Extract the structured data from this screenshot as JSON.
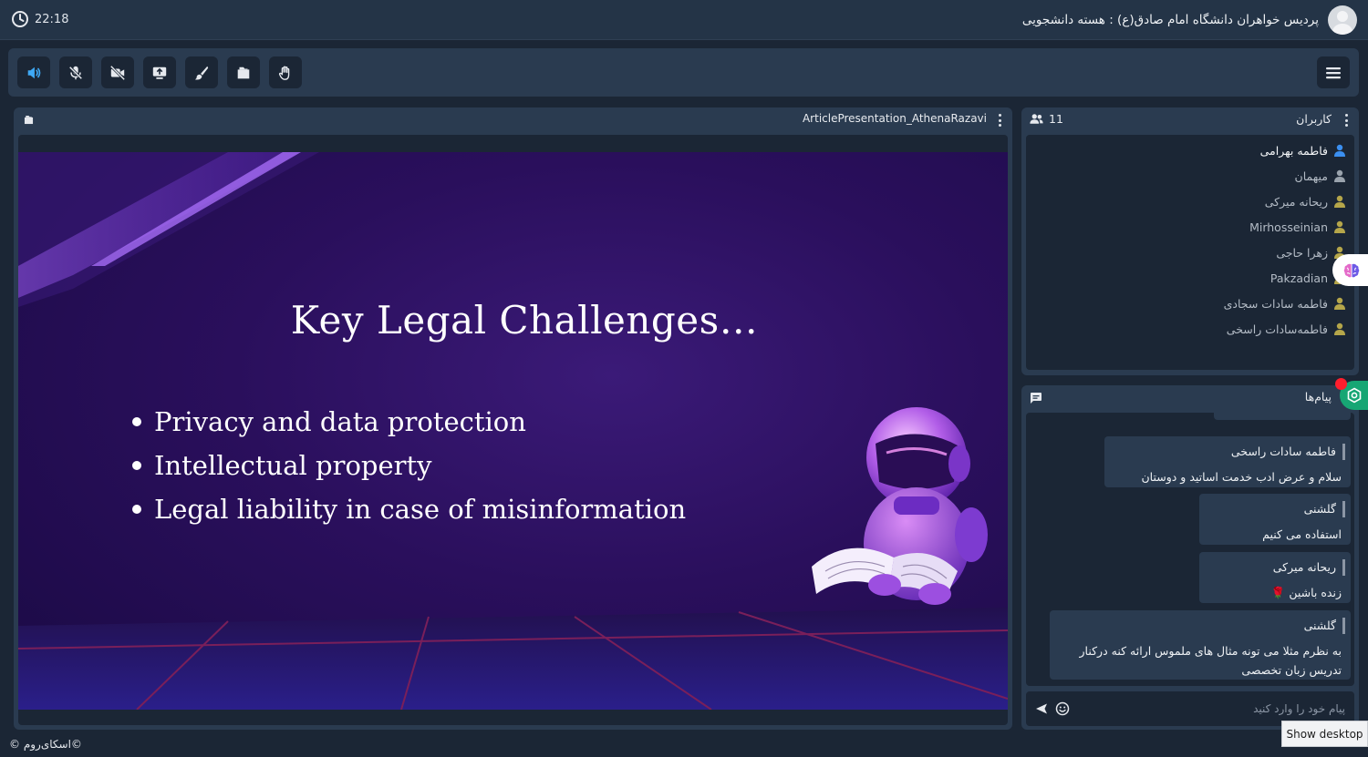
{
  "header": {
    "time": "22:18",
    "room_title": "پردیس خواهران دانشگاه امام صادق(ع) : هسته دانشجویی"
  },
  "toolbar": {
    "tools": [
      "speaker-icon",
      "mic-off-icon",
      "camera-off-icon",
      "share-screen-icon",
      "brush-icon",
      "folder-icon",
      "raise-hand-icon"
    ],
    "menu": "hamburger-menu-icon"
  },
  "presentation": {
    "file_name": "ArticlePresentation_AthenaRazavi",
    "slide": {
      "title": "Key Legal Challenges…",
      "bullets": [
        "Privacy and data protection",
        "Intellectual property",
        "Legal liability in case of misinformation"
      ]
    }
  },
  "users_panel": {
    "title": "کاربران",
    "count": "11",
    "users": [
      {
        "name": "فاطمه بهرامی",
        "color": "#3b8ff0"
      },
      {
        "name": "میهمان",
        "color": "#9aa3ad"
      },
      {
        "name": "ریحانه میرکی",
        "color": "#b5a64a"
      },
      {
        "name": "Mirhosseinian",
        "color": "#b5a64a"
      },
      {
        "name": "زهرا حاجی",
        "color": "#b5a64a"
      },
      {
        "name": "Pakzadian",
        "color": "#b5a64a"
      },
      {
        "name": "فاطمه سادات سجادی",
        "color": "#b5a64a"
      },
      {
        "name": "فاطمه‌سادات راسخی",
        "color": "#b5a64a"
      }
    ]
  },
  "messages_panel": {
    "title": "پیام‌ها",
    "messages": [
      {
        "sender": "فاطمه سادات راسخی",
        "text": "سلام و عرض ادب خدمت اساتید و دوستان"
      },
      {
        "sender": "گلشنی",
        "text": "استفاده می کنیم"
      },
      {
        "sender": "ریحانه میرکی",
        "text": "زنده باشین 🌹"
      },
      {
        "sender": "گلشنی",
        "text": "به نظرم مثلا می تونه مثال های ملموس ارائه کنه درکنار تدریس زبان تخصصی"
      }
    ],
    "compose_placeholder": "پیام خود را وارد کنید"
  },
  "footer": {
    "brand": "©اسکای‌روم ©",
    "show_desktop": "Show desktop"
  },
  "colors": {
    "accent": "#3fa9f5",
    "panel": "#2a3b50",
    "background": "#1b2635",
    "notification": "#ff1e2d",
    "hex_button": "#17a674"
  }
}
